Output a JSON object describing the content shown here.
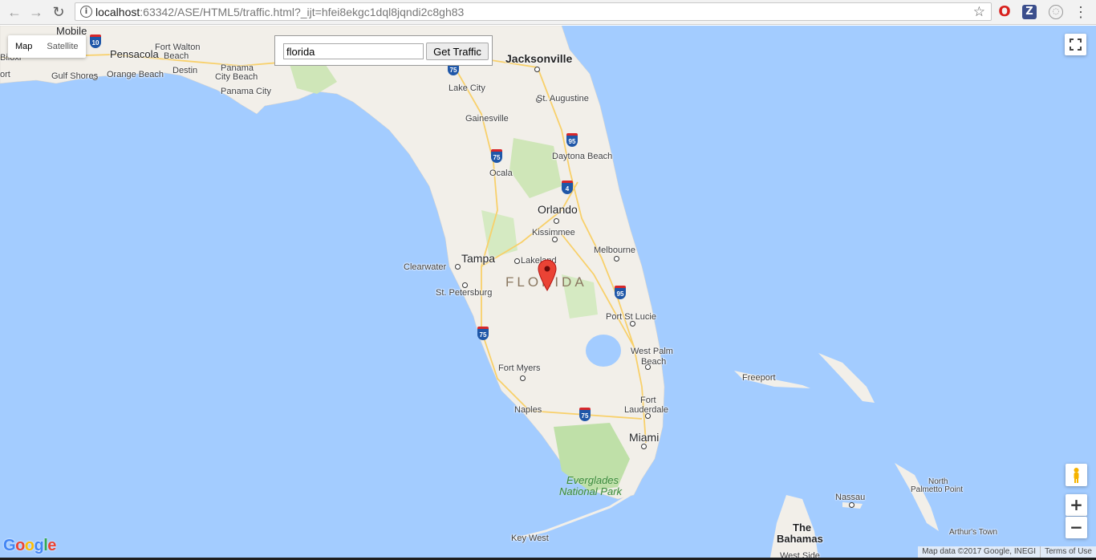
{
  "browser": {
    "url_host": "localhost",
    "url_rest": ":63342/ASE/HTML5/traffic.html?_ijt=hfei8ekgc1dql8jqndi2c8gh83",
    "back_icon": "back-arrow-icon",
    "forward_icon": "forward-arrow-icon",
    "reload_icon": "reload-icon",
    "info_glyph": "i",
    "star_glyph": "☆",
    "ext_z": "Z",
    "menu_glyph": "⋮"
  },
  "map_type": {
    "map_label": "Map",
    "satellite_label": "Satellite",
    "selected": "Map"
  },
  "search": {
    "value": "florida",
    "button_label": "Get Traffic"
  },
  "zoom": {
    "in_label": "+",
    "out_label": "−"
  },
  "labels": {
    "mobile": "Mobile",
    "biloxi": "Biloxi",
    "ort": "ort",
    "pensacola": "Pensacola",
    "fort_walton_1": "Fort Walton",
    "fort_walton_2": "Beach",
    "destin": "Destin",
    "gulf_shores": "Gulf Shores",
    "orange_beach": "Orange Beach",
    "panama_city_beach_1": "Panama",
    "panama_city_beach_2": "City Beach",
    "panama_city": "Panama City",
    "jacksonville": "Jacksonville",
    "lake_city": "Lake City",
    "st_augustine": "St. Augustine",
    "gainesville": "Gainesville",
    "daytona": "Daytona Beach",
    "ocala": "Ocala",
    "orlando": "Orlando",
    "kissimmee": "Kissimmee",
    "melbourne": "Melbourne",
    "clearwater": "Clearwater",
    "tampa": "Tampa",
    "lakeland": "Lakeland",
    "st_petersburg": "St. Petersburg",
    "florida": "FLORIDA",
    "port_st_lucie": "Port St Lucie",
    "west_palm_1": "West Palm",
    "west_palm_2": "Beach",
    "fort_myers": "Fort Myers",
    "naples": "Naples",
    "fort_lauderdale_1": "Fort",
    "fort_lauderdale_2": "Lauderdale",
    "miami": "Miami",
    "everglades_1": "Everglades",
    "everglades_2": "National Park",
    "key_west": "Key West",
    "freeport": "Freeport",
    "nassau": "Nassau",
    "north_palmetto_1": "North",
    "north_palmetto_2": "Palmetto Point",
    "bahamas_1": "The",
    "bahamas_2": "Bahamas",
    "west_side": "West Side",
    "arthurs_town": "Arthur's Town"
  },
  "shields": {
    "i10": "10",
    "i75a": "75",
    "i75b": "75",
    "i75c": "75",
    "i75d": "75",
    "i95a": "95",
    "i95b": "95",
    "i4": "4"
  },
  "attribution": {
    "map_data": "Map data ©2017 Google, INEGI",
    "terms": "Terms of Use"
  },
  "google_logo": {
    "G": "G",
    "o1": "o",
    "o2": "o",
    "g": "g",
    "l": "l",
    "e": "e"
  },
  "colors": {
    "water": "#a3ccff",
    "land": "#f2efe9",
    "marker": "#ea4335"
  }
}
